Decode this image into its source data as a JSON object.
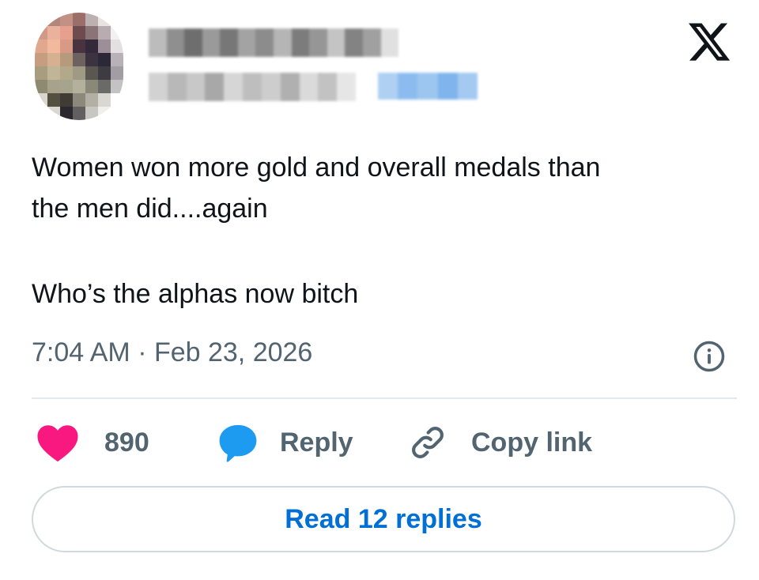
{
  "tweet": {
    "line1": "Women won more gold and overall medals than",
    "line2": "the men did....again",
    "line3": "Who’s the alphas now bitch",
    "timestamp": "7:04 AM · Feb 23, 2026"
  },
  "actions": {
    "likes_count": "890",
    "reply_label": "Reply",
    "copy_link_label": "Copy link"
  },
  "read_replies_label": "Read 12 replies",
  "icons": {
    "brand": "x-logo-icon",
    "info": "info-icon",
    "like": "heart-icon",
    "reply": "reply-bubble-icon",
    "copy": "link-icon"
  },
  "colors": {
    "text": "#0f1419",
    "muted": "#536471",
    "heart": "#f91880",
    "reply_bubble": "#1d9bf0",
    "link_blue": "#006fd6",
    "border": "#cfd9de"
  }
}
